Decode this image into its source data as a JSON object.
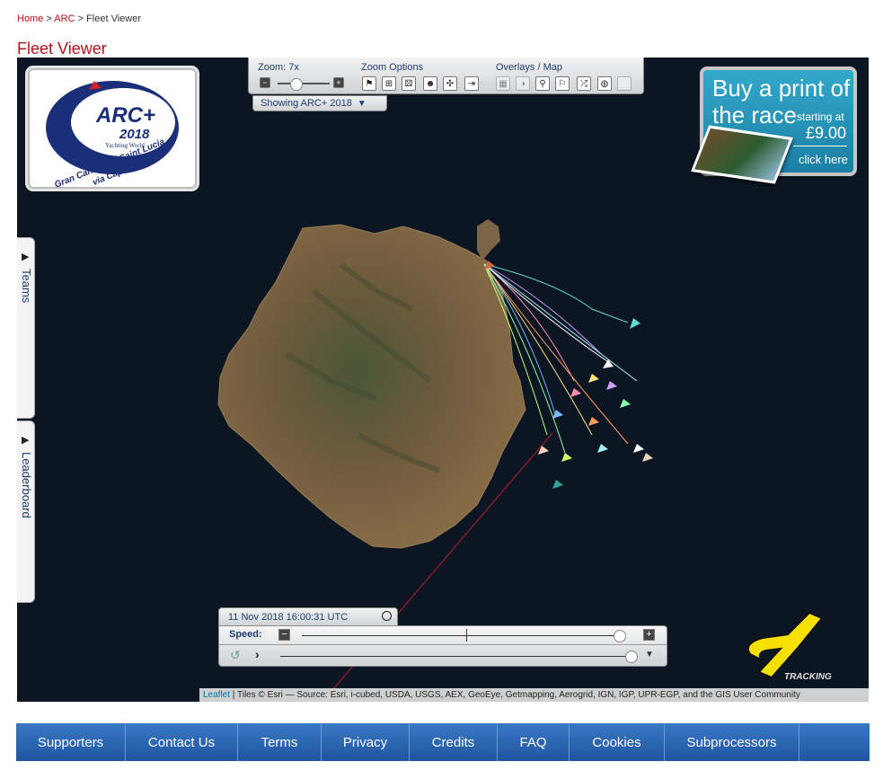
{
  "breadcrumb": {
    "home": "Home",
    "sep1": " > ",
    "arc": "ARC",
    "sep2": " > ",
    "current": "Fleet Viewer"
  },
  "page_title": "Fleet Viewer",
  "logo": {
    "title": "ARC+",
    "year": "2018",
    "sponsor": "Yachting World",
    "route_line1": "Gran Canaria to Saint Lucia",
    "route_line2": "via Cape Verde"
  },
  "toolbar": {
    "zoom_label": "Zoom: 7x",
    "zoom_minus": "−",
    "zoom_plus": "+",
    "zoom_options_label": "Zoom Options",
    "overlays_label": "Overlays / Map",
    "showing_label": "Showing ARC+ 2018",
    "zoom_level_fraction": 0.35
  },
  "ad": {
    "line1": "Buy a print of",
    "line2": "the race",
    "line3": "starting at",
    "price": "£9.00",
    "cta": "click here"
  },
  "side_tabs": {
    "teams": "Teams",
    "leaderboard": "Leaderboard"
  },
  "player": {
    "timestamp": "11 Nov 2018 16:00:31 UTC",
    "speed_label": "Speed:",
    "speed_minus": "−",
    "speed_plus": "+",
    "speed_fraction": 0.98,
    "timeline_fraction": 1.0
  },
  "brand": {
    "tracking_text": "TRACKING"
  },
  "attribution": {
    "leaflet": "Leaflet",
    "text": " | Tiles © Esri — Source: Esri, i-cubed, USDA, USGS, AEX, GeoEye, Getmapping, Aerogrid, IGN, IGP, UPR-EGP, and the GIS User Community"
  },
  "footer": {
    "items": [
      "Supporters",
      "Contact Us",
      "Terms",
      "Privacy",
      "Credits",
      "FAQ",
      "Cookies",
      "Subprocessors"
    ]
  },
  "colors": {
    "brand_red": "#b3141a",
    "map_sea": "#0c1622",
    "footer_blue": "#2a64b0",
    "tracking_yellow": "#f5e000"
  }
}
